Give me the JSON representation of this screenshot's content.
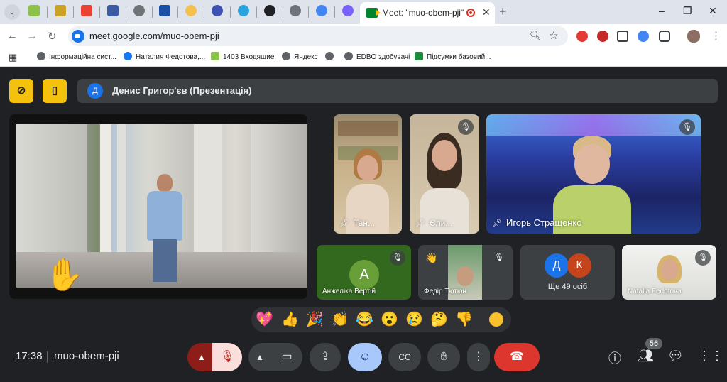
{
  "browser": {
    "active_tab_title": "Meet: \"muo-obem-pji\"",
    "new_tab_label": "+",
    "url": "meet.google.com/muo-obem-pji",
    "window_controls": [
      "–",
      "❐",
      "✕"
    ],
    "nav": {
      "back": "←",
      "forward": "→",
      "reload": "↻"
    }
  },
  "bookmarks": [
    {
      "label": "Інформаційна сист...",
      "color": "#5f6368"
    },
    {
      "label": "Наталия Федотова,...",
      "color": "#1877f2"
    },
    {
      "label": "1403 Входящие",
      "color": "#8bc34a"
    },
    {
      "label": "Яндекс",
      "color": "#5f6368"
    },
    {
      "label": "EDBO здобувачі",
      "color": "#5f6368"
    },
    {
      "label": "Підсумки базовий...",
      "color": "#1e8e3e"
    }
  ],
  "meet": {
    "presenter_avatar": "Д",
    "presenter_label": "Денис Григор'єв (Презентація)",
    "tiles": [
      {
        "name": "Тан..."
      },
      {
        "name": "Єли..."
      },
      {
        "name": "Игорь Стращенко"
      },
      {
        "name": "Анжеліка Вертій",
        "avatar": "А"
      },
      {
        "name": "Федір Тютюн"
      },
      {
        "name": "Ще 49 осіб",
        "avatars": [
          "Д",
          "К"
        ]
      },
      {
        "name": "Natalia Fedotova"
      }
    ],
    "reactions": [
      "💖",
      "👍",
      "🎉",
      "👏",
      "😂",
      "😮",
      "😢",
      "🤔",
      "👎"
    ],
    "time": "17:38",
    "meeting_code": "muo-obem-pji",
    "participant_count": "56"
  },
  "colors": {
    "accent_yellow": "#f4c20d",
    "end_call_red": "#dc362e",
    "active_blue": "#a8c7fa",
    "meet_bg": "#202124"
  }
}
